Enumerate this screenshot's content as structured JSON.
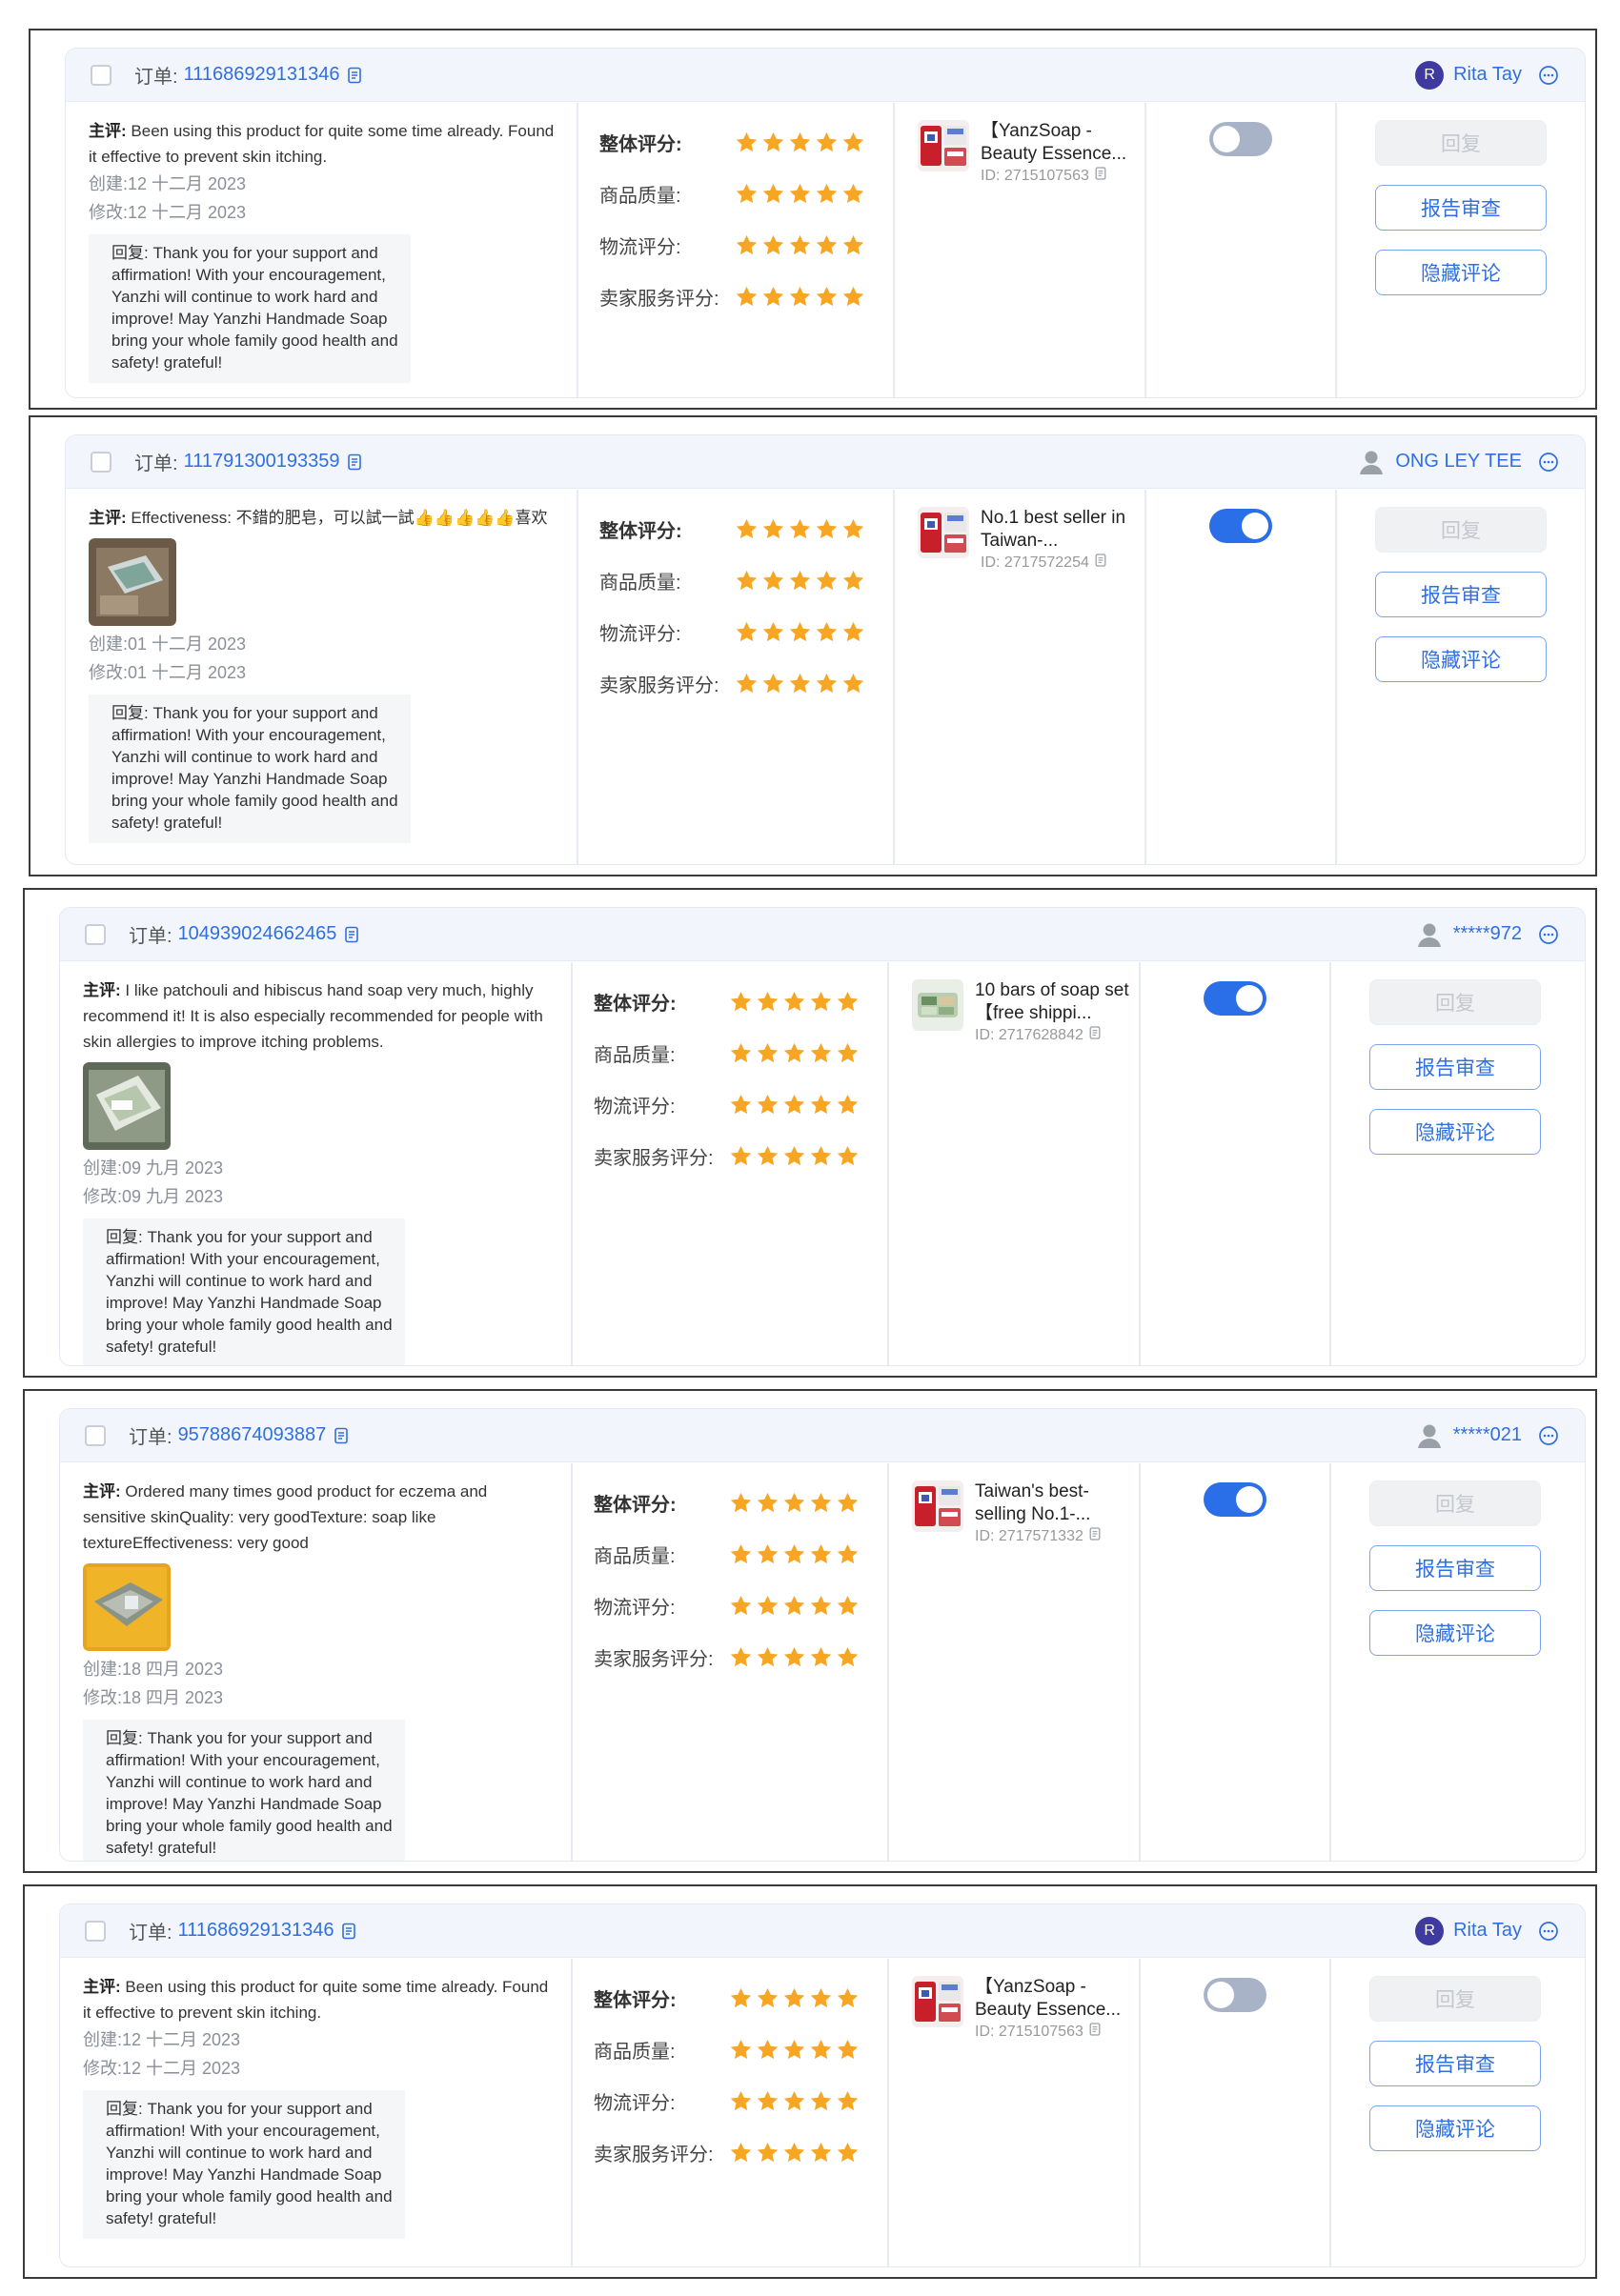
{
  "labels": {
    "order": "订单:",
    "main_review": "主评:",
    "reply_prefix": "回复:",
    "ratings": [
      "整体评分:",
      "商品质量:",
      "物流评分:",
      "卖家服务评分:"
    ],
    "buttons": {
      "reply": "回复",
      "report": "报告审查",
      "hide": "隐藏评论"
    }
  },
  "colors": {
    "accent": "#2f6fe0",
    "star": "#f7a623",
    "toggle_on": "#2a6ee8",
    "toggle_off": "#a9b3c7"
  },
  "reviews": [
    {
      "order_id": "111686929131346",
      "user": {
        "name": "Rita Tay",
        "avatar": "letter",
        "initial": "R"
      },
      "comment": "Been using this product for quite some time already. Found it effective to prevent skin itching.",
      "has_image": false,
      "created": "创建:12 十二月 2023",
      "modified": "修改:12 十二月 2023",
      "reply": "Thank you for your support and affirmation! With your encouragement, Yanzhi will continue to work hard and improve! May Yanzhi Handmade Soap bring your whole family good health and safety! grateful!",
      "ratings": [
        5,
        5,
        5,
        5
      ],
      "product": {
        "title": "【YanzSoap - Beauty Essence...",
        "id": "ID: 2715107563",
        "thumb": "red"
      },
      "toggle_on": false
    },
    {
      "order_id": "111791300193359",
      "user": {
        "name": "ONG LEY TEE",
        "avatar": "person",
        "initial": ""
      },
      "comment": "Effectiveness: 不錯的肥皂，可以試一試👍👍👍👍👍喜欢",
      "has_image": true,
      "image": "box",
      "created": "创建:01 十二月 2023",
      "modified": "修改:01 十二月 2023",
      "reply": "Thank you for your support and affirmation! With your encouragement, Yanzhi will continue to work hard and improve! May Yanzhi Handmade Soap bring your whole family good health and safety! grateful!",
      "ratings": [
        5,
        5,
        5,
        5
      ],
      "product": {
        "title": "No.1 best seller in Taiwan-...",
        "id": "ID: 2717572254",
        "thumb": "red"
      },
      "toggle_on": true
    },
    {
      "order_id": "104939024662465",
      "user": {
        "name": "*****972",
        "avatar": "person",
        "initial": ""
      },
      "comment": "I like patchouli and hibiscus hand soap very much, highly recommend it! It is also especially recommended for people with skin allergies to improve itching problems.",
      "has_image": true,
      "image": "soap",
      "created": "创建:09 九月 2023",
      "modified": "修改:09 九月 2023",
      "reply": "Thank you for your support and affirmation! With your encouragement, Yanzhi will continue to work hard and improve! May Yanzhi Handmade Soap bring your whole family good health and safety! grateful!",
      "ratings": [
        5,
        5,
        5,
        5
      ],
      "product": {
        "title": "10 bars of soap set【free shippi...",
        "id": "ID: 2717628842",
        "thumb": "green"
      },
      "toggle_on": true
    },
    {
      "order_id": "95788674093887",
      "user": {
        "name": "*****021",
        "avatar": "person",
        "initial": ""
      },
      "comment": "Ordered many times good product for eczema and sensitive skinQuality: very goodTexture: soap like textureEffectiveness: very good",
      "has_image": true,
      "image": "yellow",
      "created": "创建:18 四月 2023",
      "modified": "修改:18 四月 2023",
      "reply": "Thank you for your support and affirmation! With your encouragement, Yanzhi will continue to work hard and improve! May Yanzhi Handmade Soap bring your whole family good health and safety! grateful!",
      "ratings": [
        5,
        5,
        5,
        5
      ],
      "product": {
        "title": "Taiwan's best-selling No.1-...",
        "id": "ID: 2717571332",
        "thumb": "red"
      },
      "toggle_on": true
    },
    {
      "order_id": "111686929131346",
      "user": {
        "name": "Rita Tay",
        "avatar": "letter",
        "initial": "R"
      },
      "comment": "Been using this product for quite some time already. Found it effective to prevent skin itching.",
      "has_image": false,
      "created": "创建:12 十二月 2023",
      "modified": "修改:12 十二月 2023",
      "reply": "Thank you for your support and affirmation! With your encouragement, Yanzhi will continue to work hard and improve! May Yanzhi Handmade Soap bring your whole family good health and safety! grateful!",
      "ratings": [
        5,
        5,
        5,
        5
      ],
      "product": {
        "title": "【YanzSoap - Beauty Essence...",
        "id": "ID: 2715107563",
        "thumb": "red"
      },
      "toggle_on": false
    }
  ]
}
